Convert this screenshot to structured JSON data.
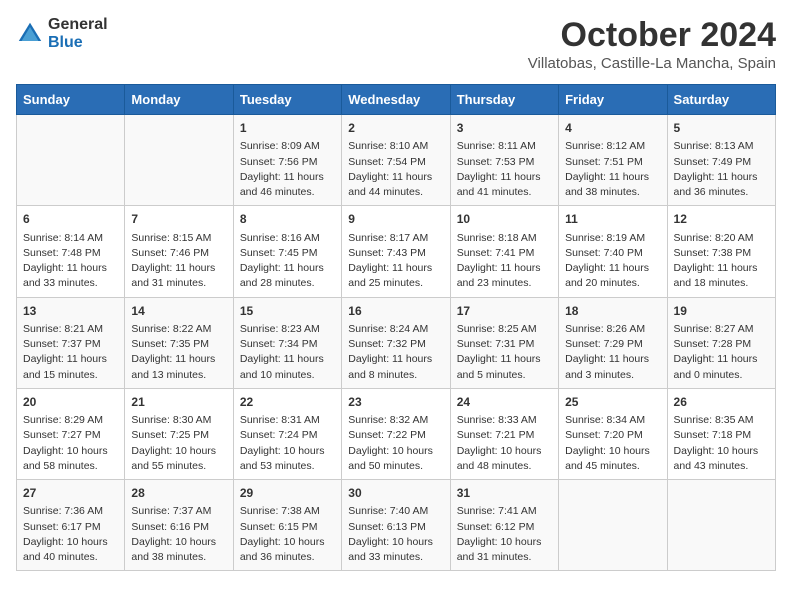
{
  "logo": {
    "line1": "General",
    "line2": "Blue"
  },
  "title": "October 2024",
  "location": "Villatobas, Castille-La Mancha, Spain",
  "weekdays": [
    "Sunday",
    "Monday",
    "Tuesday",
    "Wednesday",
    "Thursday",
    "Friday",
    "Saturday"
  ],
  "weeks": [
    [
      {
        "day": "",
        "info": ""
      },
      {
        "day": "",
        "info": ""
      },
      {
        "day": "1",
        "sunrise": "8:09 AM",
        "sunset": "7:56 PM",
        "daylight": "11 hours and 46 minutes."
      },
      {
        "day": "2",
        "sunrise": "8:10 AM",
        "sunset": "7:54 PM",
        "daylight": "11 hours and 44 minutes."
      },
      {
        "day": "3",
        "sunrise": "8:11 AM",
        "sunset": "7:53 PM",
        "daylight": "11 hours and 41 minutes."
      },
      {
        "day": "4",
        "sunrise": "8:12 AM",
        "sunset": "7:51 PM",
        "daylight": "11 hours and 38 minutes."
      },
      {
        "day": "5",
        "sunrise": "8:13 AM",
        "sunset": "7:49 PM",
        "daylight": "11 hours and 36 minutes."
      }
    ],
    [
      {
        "day": "6",
        "sunrise": "8:14 AM",
        "sunset": "7:48 PM",
        "daylight": "11 hours and 33 minutes."
      },
      {
        "day": "7",
        "sunrise": "8:15 AM",
        "sunset": "7:46 PM",
        "daylight": "11 hours and 31 minutes."
      },
      {
        "day": "8",
        "sunrise": "8:16 AM",
        "sunset": "7:45 PM",
        "daylight": "11 hours and 28 minutes."
      },
      {
        "day": "9",
        "sunrise": "8:17 AM",
        "sunset": "7:43 PM",
        "daylight": "11 hours and 25 minutes."
      },
      {
        "day": "10",
        "sunrise": "8:18 AM",
        "sunset": "7:41 PM",
        "daylight": "11 hours and 23 minutes."
      },
      {
        "day": "11",
        "sunrise": "8:19 AM",
        "sunset": "7:40 PM",
        "daylight": "11 hours and 20 minutes."
      },
      {
        "day": "12",
        "sunrise": "8:20 AM",
        "sunset": "7:38 PM",
        "daylight": "11 hours and 18 minutes."
      }
    ],
    [
      {
        "day": "13",
        "sunrise": "8:21 AM",
        "sunset": "7:37 PM",
        "daylight": "11 hours and 15 minutes."
      },
      {
        "day": "14",
        "sunrise": "8:22 AM",
        "sunset": "7:35 PM",
        "daylight": "11 hours and 13 minutes."
      },
      {
        "day": "15",
        "sunrise": "8:23 AM",
        "sunset": "7:34 PM",
        "daylight": "11 hours and 10 minutes."
      },
      {
        "day": "16",
        "sunrise": "8:24 AM",
        "sunset": "7:32 PM",
        "daylight": "11 hours and 8 minutes."
      },
      {
        "day": "17",
        "sunrise": "8:25 AM",
        "sunset": "7:31 PM",
        "daylight": "11 hours and 5 minutes."
      },
      {
        "day": "18",
        "sunrise": "8:26 AM",
        "sunset": "7:29 PM",
        "daylight": "11 hours and 3 minutes."
      },
      {
        "day": "19",
        "sunrise": "8:27 AM",
        "sunset": "7:28 PM",
        "daylight": "11 hours and 0 minutes."
      }
    ],
    [
      {
        "day": "20",
        "sunrise": "8:29 AM",
        "sunset": "7:27 PM",
        "daylight": "10 hours and 58 minutes."
      },
      {
        "day": "21",
        "sunrise": "8:30 AM",
        "sunset": "7:25 PM",
        "daylight": "10 hours and 55 minutes."
      },
      {
        "day": "22",
        "sunrise": "8:31 AM",
        "sunset": "7:24 PM",
        "daylight": "10 hours and 53 minutes."
      },
      {
        "day": "23",
        "sunrise": "8:32 AM",
        "sunset": "7:22 PM",
        "daylight": "10 hours and 50 minutes."
      },
      {
        "day": "24",
        "sunrise": "8:33 AM",
        "sunset": "7:21 PM",
        "daylight": "10 hours and 48 minutes."
      },
      {
        "day": "25",
        "sunrise": "8:34 AM",
        "sunset": "7:20 PM",
        "daylight": "10 hours and 45 minutes."
      },
      {
        "day": "26",
        "sunrise": "8:35 AM",
        "sunset": "7:18 PM",
        "daylight": "10 hours and 43 minutes."
      }
    ],
    [
      {
        "day": "27",
        "sunrise": "7:36 AM",
        "sunset": "6:17 PM",
        "daylight": "10 hours and 40 minutes."
      },
      {
        "day": "28",
        "sunrise": "7:37 AM",
        "sunset": "6:16 PM",
        "daylight": "10 hours and 38 minutes."
      },
      {
        "day": "29",
        "sunrise": "7:38 AM",
        "sunset": "6:15 PM",
        "daylight": "10 hours and 36 minutes."
      },
      {
        "day": "30",
        "sunrise": "7:40 AM",
        "sunset": "6:13 PM",
        "daylight": "10 hours and 33 minutes."
      },
      {
        "day": "31",
        "sunrise": "7:41 AM",
        "sunset": "6:12 PM",
        "daylight": "10 hours and 31 minutes."
      },
      {
        "day": "",
        "info": ""
      },
      {
        "day": "",
        "info": ""
      }
    ]
  ]
}
